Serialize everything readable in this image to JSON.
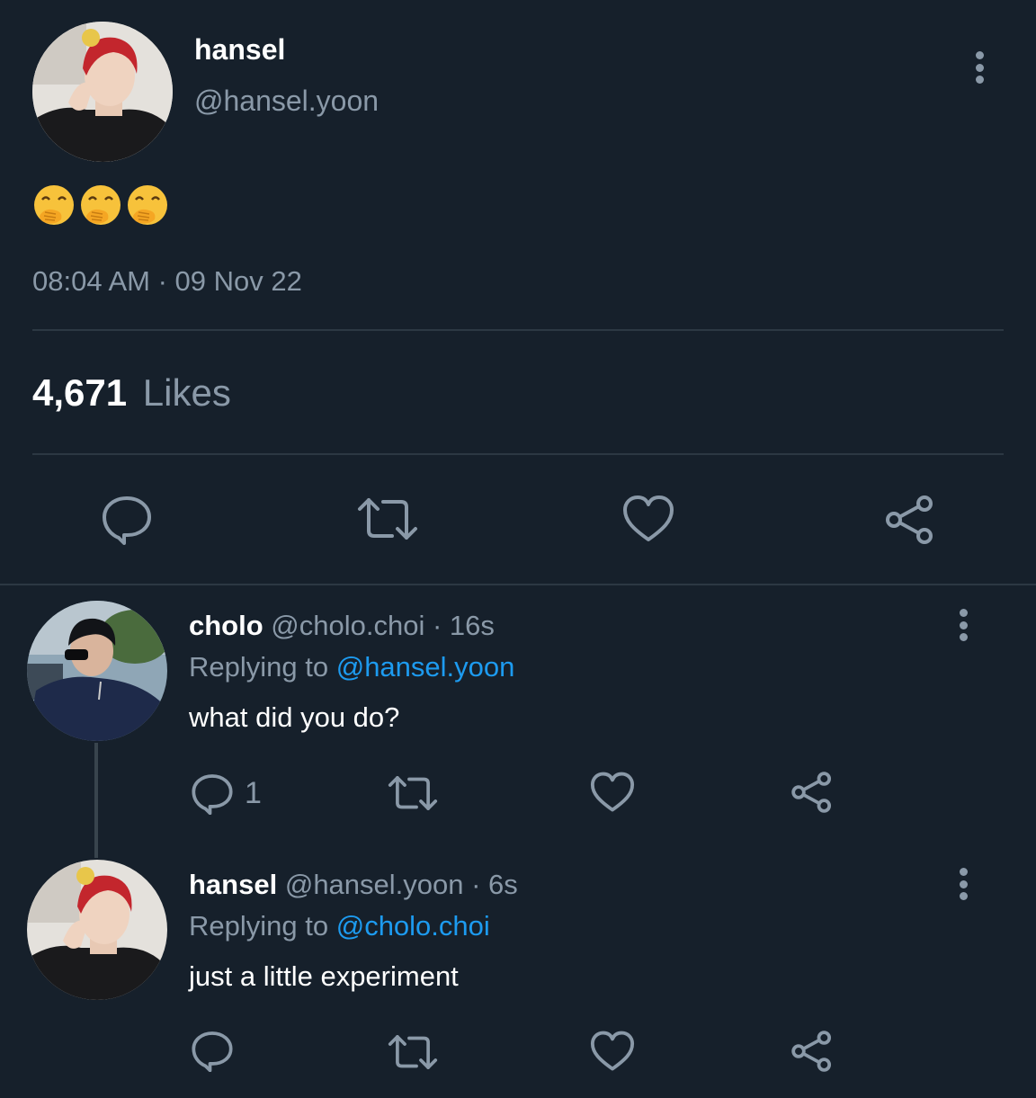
{
  "main_tweet": {
    "display_name": "hansel",
    "handle": "@hansel.yoon",
    "emoji_count": 3,
    "emoji_name": "hand-over-mouth-emoji",
    "timestamp": "08:04 AM · 09 Nov 22",
    "likes_count": "4,671",
    "likes_label": "Likes"
  },
  "replies": [
    {
      "display_name": "cholo",
      "handle": "@cholo.choi",
      "time": "· 16s",
      "replying_prefix": "Replying to",
      "replying_to": "@hansel.yoon",
      "text": "what did you do?",
      "reply_count": "1"
    },
    {
      "display_name": "hansel",
      "handle": "@hansel.yoon",
      "time": "· 6s",
      "replying_prefix": "Replying to",
      "replying_to": "@cholo.choi",
      "text": "just a little experiment",
      "reply_count": ""
    }
  ],
  "colors": {
    "background": "#16202b",
    "muted": "#8a99a8",
    "link": "#1d9bf0",
    "divider": "#2c3843"
  },
  "icons": [
    "more-vertical-icon",
    "reply-icon",
    "retweet-icon",
    "like-icon",
    "share-icon"
  ]
}
